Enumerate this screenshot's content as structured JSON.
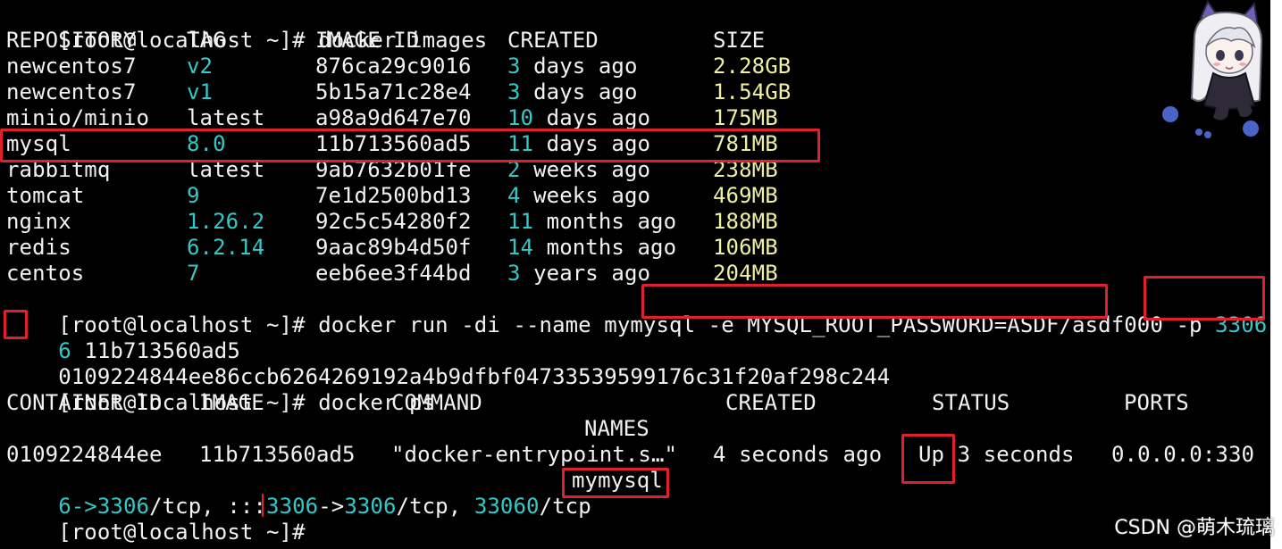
{
  "terminal": {
    "prompt": "[root@localhost ~]# ",
    "cmd_images": "docker images",
    "images_headers": {
      "repository": "REPOSITORY",
      "tag": "TAG",
      "image_id": "IMAGE ID",
      "created": "CREATED",
      "size": "SIZE"
    },
    "images": [
      {
        "repository": "newcentos7",
        "tag": "v2",
        "image_id": "876ca29c9016",
        "created_num": "3",
        "created_unit": " days ago",
        "size": "2.28GB"
      },
      {
        "repository": "newcentos7",
        "tag": "v1",
        "image_id": "5b15a71c28e4",
        "created_num": "3",
        "created_unit": " days ago",
        "size": "1.54GB"
      },
      {
        "repository": "minio/minio",
        "tag": "latest",
        "image_id": "a98a9d647e70",
        "created_num": "10",
        "created_unit": " days ago",
        "size": "175MB"
      },
      {
        "repository": "mysql",
        "tag": "8.0",
        "image_id": "11b713560ad5",
        "created_num": "11",
        "created_unit": " days ago",
        "size": "781MB"
      },
      {
        "repository": "rabbitmq",
        "tag": "latest",
        "image_id": "9ab7632b01fe",
        "created_num": "2",
        "created_unit": " weeks ago",
        "size": "238MB"
      },
      {
        "repository": "tomcat",
        "tag": "9",
        "image_id": "7e1d2500bd13",
        "created_num": "4",
        "created_unit": " weeks ago",
        "size": "469MB"
      },
      {
        "repository": "nginx",
        "tag": "1.26.2",
        "image_id": "92c5c54280f2",
        "created_num": "11",
        "created_unit": " months ago",
        "size": "188MB"
      },
      {
        "repository": "redis",
        "tag": "6.2.14",
        "image_id": "9aac89b4d50f",
        "created_num": "14",
        "created_unit": " months ago",
        "size": "106MB"
      },
      {
        "repository": "centos",
        "tag": "7",
        "image_id": "eeb6ee3f44bd",
        "created_num": "3",
        "created_unit": " years ago",
        "size": "204MB"
      }
    ],
    "run_cmd_a": "docker run -di --name mymysql ",
    "run_env": "-e MYSQL_ROOT_PASSWORD=ASDF/asdf000",
    "run_p": " -p ",
    "run_port_a": "3306",
    "run_colon": ":",
    "run_port_b": "330",
    "run_port_c": "6",
    "run_image": " 11b713560ad5",
    "container_hash": "0109224844ee86ccb6264269192a4b9dfbf04733539599176c31f20af298c244",
    "cmd_ps": "docker ps",
    "ps_headers": {
      "container_id": "CONTAINER ID",
      "image": "IMAGE",
      "command": "COMMAND",
      "created": "CREATED",
      "status": "STATUS",
      "ports": "PORTS",
      "names": "NAMES"
    },
    "ps_row": {
      "container_id": "0109224844ee",
      "image": "11b713560ad5",
      "command": "\"docker-entrypoint.s…\"",
      "created": "4 seconds ago",
      "status_up": "Up",
      "status_rest": " 3 seconds",
      "ports_a": "0.0.0.0:330",
      "ports_b1": "6->",
      "ports_b2": "3306",
      "ports_b3": "/tcp, :::",
      "ports_b4": "3306",
      "ports_b5": "->",
      "ports_b6": "3306",
      "ports_b7": "/tcp, ",
      "ports_b8": "33060",
      "ports_b9": "/tcp",
      "names": "mymysql"
    }
  },
  "watermark": "CSDN @萌木琉璃",
  "colors": {
    "background": "#000000",
    "text": "#f2f2f2",
    "cyan": "#33c9c9",
    "yellow": "#f0f0a0",
    "highlight": "#e0202a"
  },
  "icons": {
    "mascot": "anime-mascot-icon"
  }
}
